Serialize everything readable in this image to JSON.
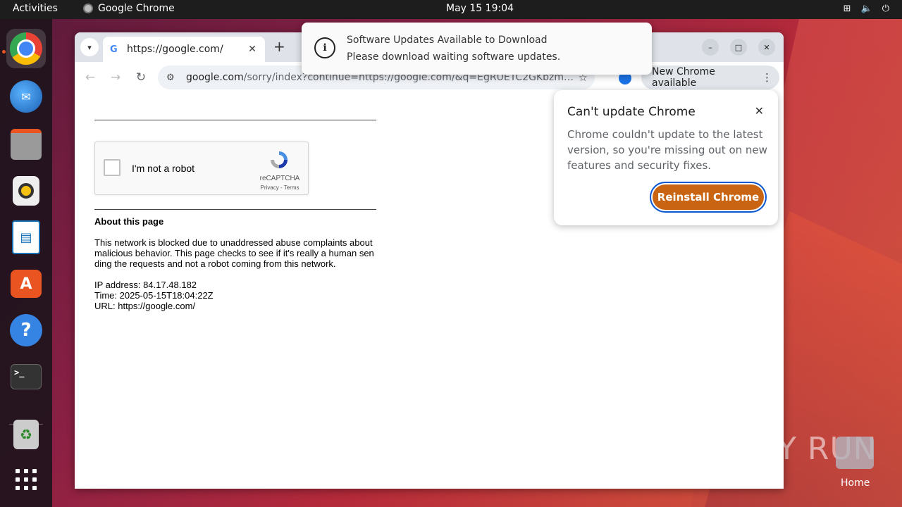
{
  "topbar": {
    "activities": "Activities",
    "app_name": "Google Chrome",
    "clock": "May 15  19:04"
  },
  "dock": {
    "items": [
      "chrome",
      "thunderbird",
      "files",
      "rhythmbox",
      "libreoffice-impress",
      "app-center",
      "help",
      "terminal",
      "trash",
      "show-apps"
    ]
  },
  "browser": {
    "tab_title": "https://google.com/",
    "address_host": "google.com",
    "address_path": "/sorry/index?continue=https://google.com/&q=EgRUETC2GKbzmMEGIjAH...",
    "update_pill": "New Chrome available"
  },
  "page": {
    "captcha_label": "I'm not a robot",
    "captcha_brand": "reCAPTCHA",
    "captcha_links": "Privacy - Terms",
    "about_title": "About this page",
    "about_body": "This network is blocked due to unaddressed abuse complaints about malicious behavior. This page checks to see if it's really a human sen ding the requests and not a robot coming from this network.",
    "ip": "IP address: 84.17.48.182",
    "time": "Time: 2025-05-15T18:04:22Z",
    "url": "URL: https://google.com/"
  },
  "bubble": {
    "title": "Can't update Chrome",
    "body": "Chrome couldn't update to the latest version, so you're missing out on new features and security fixes.",
    "button": "Reinstall Chrome"
  },
  "notification": {
    "title": "Software Updates Available to Download",
    "body": "Please download waiting software updates."
  },
  "desktop": {
    "watermark": "ANY RUN",
    "home_label": "Home"
  },
  "colors": {
    "accent_orange": "#c86412",
    "focus_blue": "#0b57d0",
    "topbar": "#1d1d1d"
  }
}
